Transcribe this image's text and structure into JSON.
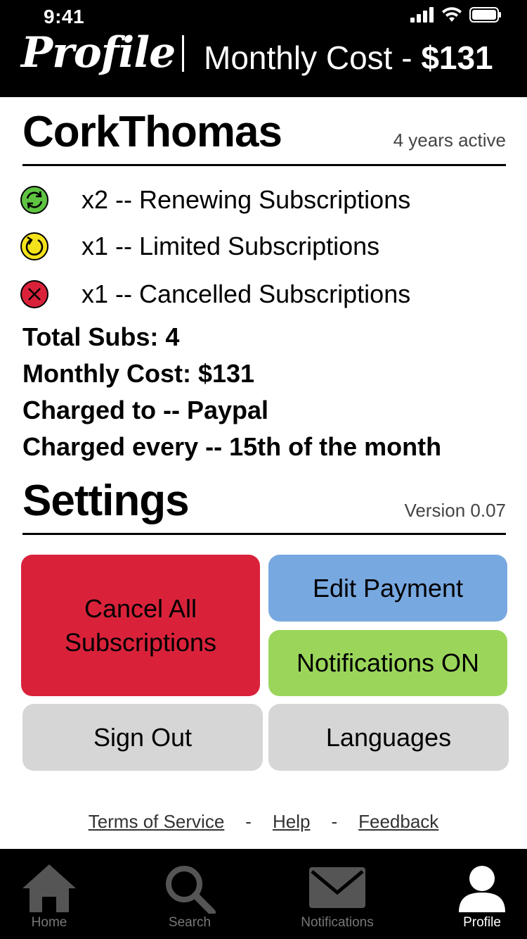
{
  "status": {
    "time": "9:41"
  },
  "header": {
    "title": "Profile",
    "cost_label": "Monthly Cost - ",
    "cost_value": "$131"
  },
  "profile": {
    "username": "CorkThomas",
    "active": "4 years active",
    "subscriptions": [
      {
        "icon": "renew-icon",
        "color": "#5ec441",
        "text": "x2 -- Renewing Subscriptions"
      },
      {
        "icon": "limited-icon",
        "color": "#f3e21b",
        "text": "x1 -- Limited Subscriptions"
      },
      {
        "icon": "cancel-circle-icon",
        "color": "#d9223a",
        "text": "x1 -- Cancelled Subscriptions"
      }
    ],
    "stats": {
      "total": "Total Subs: 4",
      "monthly": "Monthly Cost: $131",
      "charged_to": "Charged to -- Paypal",
      "charged_every": "Charged every -- 15th of the month"
    }
  },
  "settings": {
    "title": "Settings",
    "version": "Version 0.07",
    "buttons": {
      "cancel_all": "Cancel All Subscriptions",
      "edit_payment": "Edit Payment",
      "notifications": "Notifications ON",
      "sign_out": "Sign Out",
      "languages": "Languages"
    }
  },
  "footer": {
    "terms": "Terms of Service",
    "separator": "-",
    "help": "Help",
    "feedback": "Feedback"
  },
  "tabs": [
    {
      "label": "Home",
      "icon": "home-icon"
    },
    {
      "label": "Search",
      "icon": "search-icon"
    },
    {
      "label": "Notifications",
      "icon": "mail-icon"
    },
    {
      "label": "Profile",
      "icon": "person-icon",
      "active": true
    }
  ],
  "colors": {
    "cancel": "#d9223a",
    "payment": "#78a8e0",
    "notifications": "#9bd65b",
    "neutral": "#d6d6d6"
  }
}
